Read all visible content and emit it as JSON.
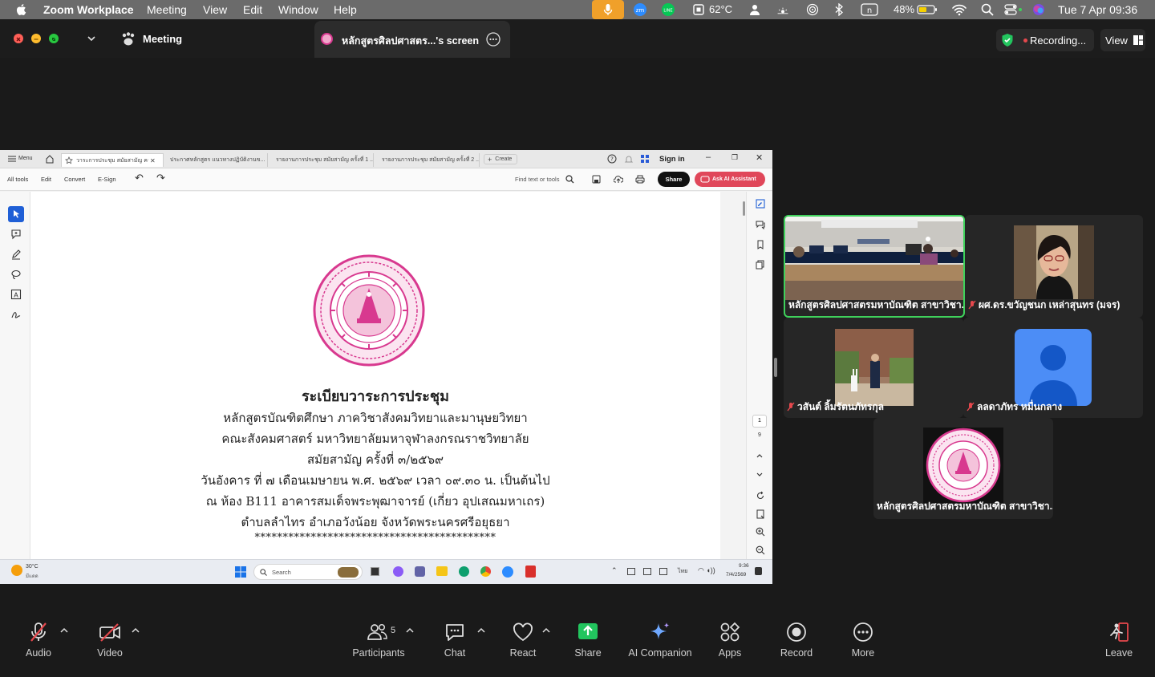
{
  "menubar": {
    "app_name": "Zoom Workplace",
    "menus": [
      "Meeting",
      "View",
      "Edit",
      "Window",
      "Help"
    ],
    "temperature": "62°C",
    "battery": "48%",
    "datetime": "Tue 7 Apr  09:36"
  },
  "titlebar": {
    "meeting_label": "Meeting",
    "share_tab_title": "หลักสูตรศิลปศาสตร...'s screen",
    "recording_label": "Recording...",
    "view_label": "View"
  },
  "pdf_viewer": {
    "tabs": [
      "วาระการประชุม สมัยสามัญ ครั้...",
      "ประกาศหลักสูตร แนวทางปฏิบัติงานข...",
      "รายงานการประชุม สมัยสามัญ ครั้งที่ 1 ...",
      "รายงานการประชุม สมัยสามัญ ครั้งที่ 2 ..."
    ],
    "menu_label": "Menu",
    "create_label": "Create",
    "sign_in": "Sign in",
    "toolbar_items": [
      "All tools",
      "Edit",
      "Convert",
      "E-Sign"
    ],
    "find_placeholder": "Find text or tools",
    "share_button": "Share",
    "ai_button": "Ask AI Assistant",
    "page_number": "1",
    "page_count": "9"
  },
  "document": {
    "title": "ระเบียบวาระการประชุม",
    "lines": [
      "หลักสูตรบัณฑิตศึกษา ภาควิชาสังคมวิทยาและมานุษยวิทยา",
      "คณะสังคมศาสตร์ มหาวิทยาลัยมหาจุฬาลงกรณราชวิทยาลัย",
      "สมัยสามัญ ครั้งที่ ๓/๒๕๖๙",
      "วันอังคาร ที่ ๗ เดือนเมษายน พ.ศ. ๒๕๖๙ เวลา ๐๙.๓๐ น. เป็นต้นไป",
      "ณ ห้อง B111 อาคารสมเด็จพระพุฒาจารย์ (เกี่ยว อุปเสณมหาเถร)",
      "ตำบลลำไทร อำเภอวังน้อย จังหวัดพระนครศรีอยุธยา",
      "*******************************************"
    ]
  },
  "windows_taskbar": {
    "weather_temp": "30°C",
    "weather_desc": "มีแดด",
    "search_placeholder": "Search",
    "time": "9:36",
    "date": "7/4/2569"
  },
  "participants": [
    {
      "name": "หลักสูตรศิลปศาสตรมหาบัณฑิต สาขาวิชา...",
      "muted": false,
      "active": true
    },
    {
      "name": "ผศ.ดร.ขวัญชนก เหล่าสุนทร (มจร)",
      "muted": true,
      "active": false
    },
    {
      "name": "วสันต์ ลิ้มรัตนภัทรกุล",
      "muted": true,
      "active": false
    },
    {
      "name": "ลลดาภัทร หมื่นกลาง",
      "muted": true,
      "active": false
    },
    {
      "name": "หลักสูตรศิลปศาสตรมหาบัณฑิต สาขาวิชา...",
      "muted": false,
      "active": false
    }
  ],
  "bottom_toolbar": {
    "audio": "Audio",
    "video": "Video",
    "participants": "Participants",
    "participants_count": "5",
    "chat": "Chat",
    "react": "React",
    "share": "Share",
    "ai_companion": "AI Companion",
    "apps": "Apps",
    "record": "Record",
    "more": "More",
    "leave": "Leave"
  },
  "colors": {
    "share_green": "#22c55e",
    "active_border": "#3fd15b",
    "seal_pink": "#d8398f",
    "mic_pill": "#f0a02a",
    "leave_red": "#e5484d"
  }
}
